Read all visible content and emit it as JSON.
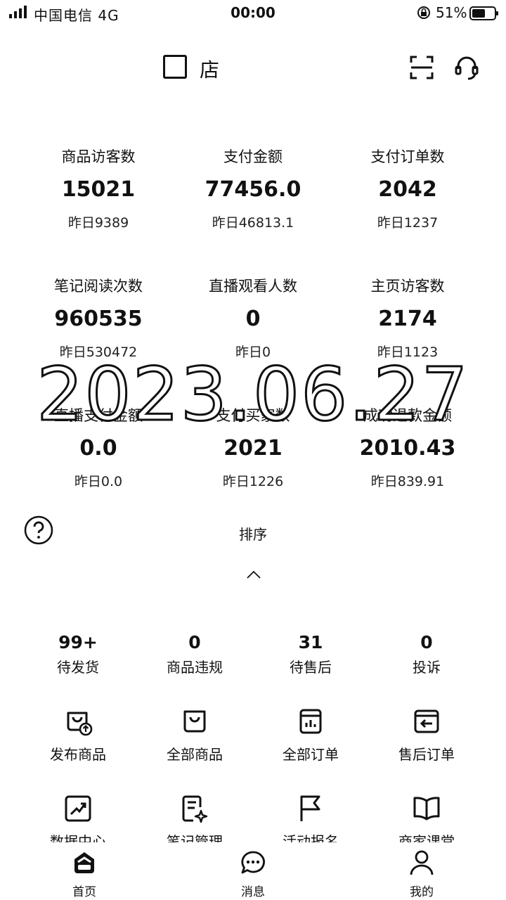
{
  "status_bar": {
    "carrier": "中国电信  4G",
    "time": "00:00",
    "battery": "51%"
  },
  "header": {
    "shop_name": "店"
  },
  "stats": [
    {
      "label": "商品访客数",
      "value": "15021",
      "yesterday": "昨日9389"
    },
    {
      "label": "支付金额",
      "value": "77456.0",
      "yesterday": "昨日46813.1"
    },
    {
      "label": "支付订单数",
      "value": "2042",
      "yesterday": "昨日1237"
    },
    {
      "label": "笔记阅读次数",
      "value": "960535",
      "yesterday": "昨日530472"
    },
    {
      "label": "直播观看人数",
      "value": "0",
      "yesterday": "昨日0"
    },
    {
      "label": "主页访客数",
      "value": "2174",
      "yesterday": "昨日1123"
    },
    {
      "label": "直播支付金额",
      "value": "0.0",
      "yesterday": "昨日0.0"
    },
    {
      "label": "支付买家数",
      "value": "2021",
      "yesterday": "昨日1226"
    },
    {
      "label": "成功退款金额",
      "value": "2010.43",
      "yesterday": "昨日839.91"
    }
  ],
  "watermark": "2023.06.27",
  "sort_label": "排序",
  "counters": [
    {
      "value": "99+",
      "label": "待发货"
    },
    {
      "value": "0",
      "label": "商品违规"
    },
    {
      "value": "31",
      "label": "待售后"
    },
    {
      "value": "0",
      "label": "投诉"
    }
  ],
  "shortcuts": [
    {
      "label": "发布商品",
      "icon": "bag-upload-icon"
    },
    {
      "label": "全部商品",
      "icon": "bag-icon"
    },
    {
      "label": "全部订单",
      "icon": "order-list-icon"
    },
    {
      "label": "售后订单",
      "icon": "return-order-icon"
    },
    {
      "label": "数据中心",
      "icon": "trend-chart-icon"
    },
    {
      "label": "笔记管理",
      "icon": "note-edit-icon"
    },
    {
      "label": "活动报名",
      "icon": "flag-icon"
    },
    {
      "label": "商家课堂",
      "icon": "book-icon"
    }
  ],
  "bottom_nav": [
    {
      "label": "首页",
      "icon": "home-icon"
    },
    {
      "label": "消息",
      "icon": "message-icon"
    },
    {
      "label": "我的",
      "icon": "profile-icon"
    }
  ]
}
